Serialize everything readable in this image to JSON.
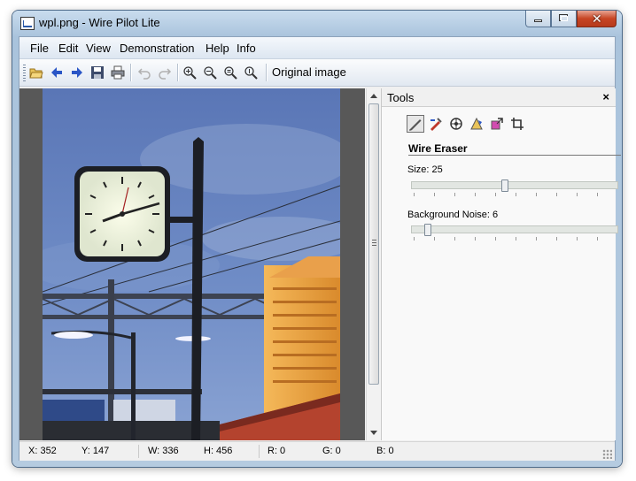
{
  "window": {
    "title": "wpl.png - Wire Pilot Lite"
  },
  "menu": [
    "File",
    "Edit",
    "View",
    "Demonstration",
    "Help",
    "Info"
  ],
  "toolbar": {
    "original_label": "Original image",
    "buttons": [
      "open-folder-icon",
      "back-arrow-icon",
      "forward-arrow-icon",
      "save-icon",
      "print-icon",
      "undo-icon",
      "redo-icon",
      "zoom-in-icon",
      "zoom-out-icon",
      "zoom-fit-icon",
      "zoom-actual-icon"
    ]
  },
  "tools": {
    "title": "Tools",
    "close": "×",
    "icons": [
      "wire-eraser-icon",
      "clone-brush-icon",
      "target-icon",
      "perspective-icon",
      "resize-icon",
      "crop-icon"
    ],
    "section_title": "Wire Eraser",
    "size_label": "Size: 25",
    "size_value": 25,
    "noise_label": "Background Noise: 6",
    "noise_value": 6
  },
  "status": {
    "x": "X: 352",
    "y": "Y: 147",
    "w": "W: 336",
    "h": "H: 456",
    "r": "R: 0",
    "g": "G: 0",
    "b": "B: 0"
  },
  "colors": {
    "close_button": "#c74524",
    "sky": "#5a78b8",
    "building": "#e8a64a"
  }
}
